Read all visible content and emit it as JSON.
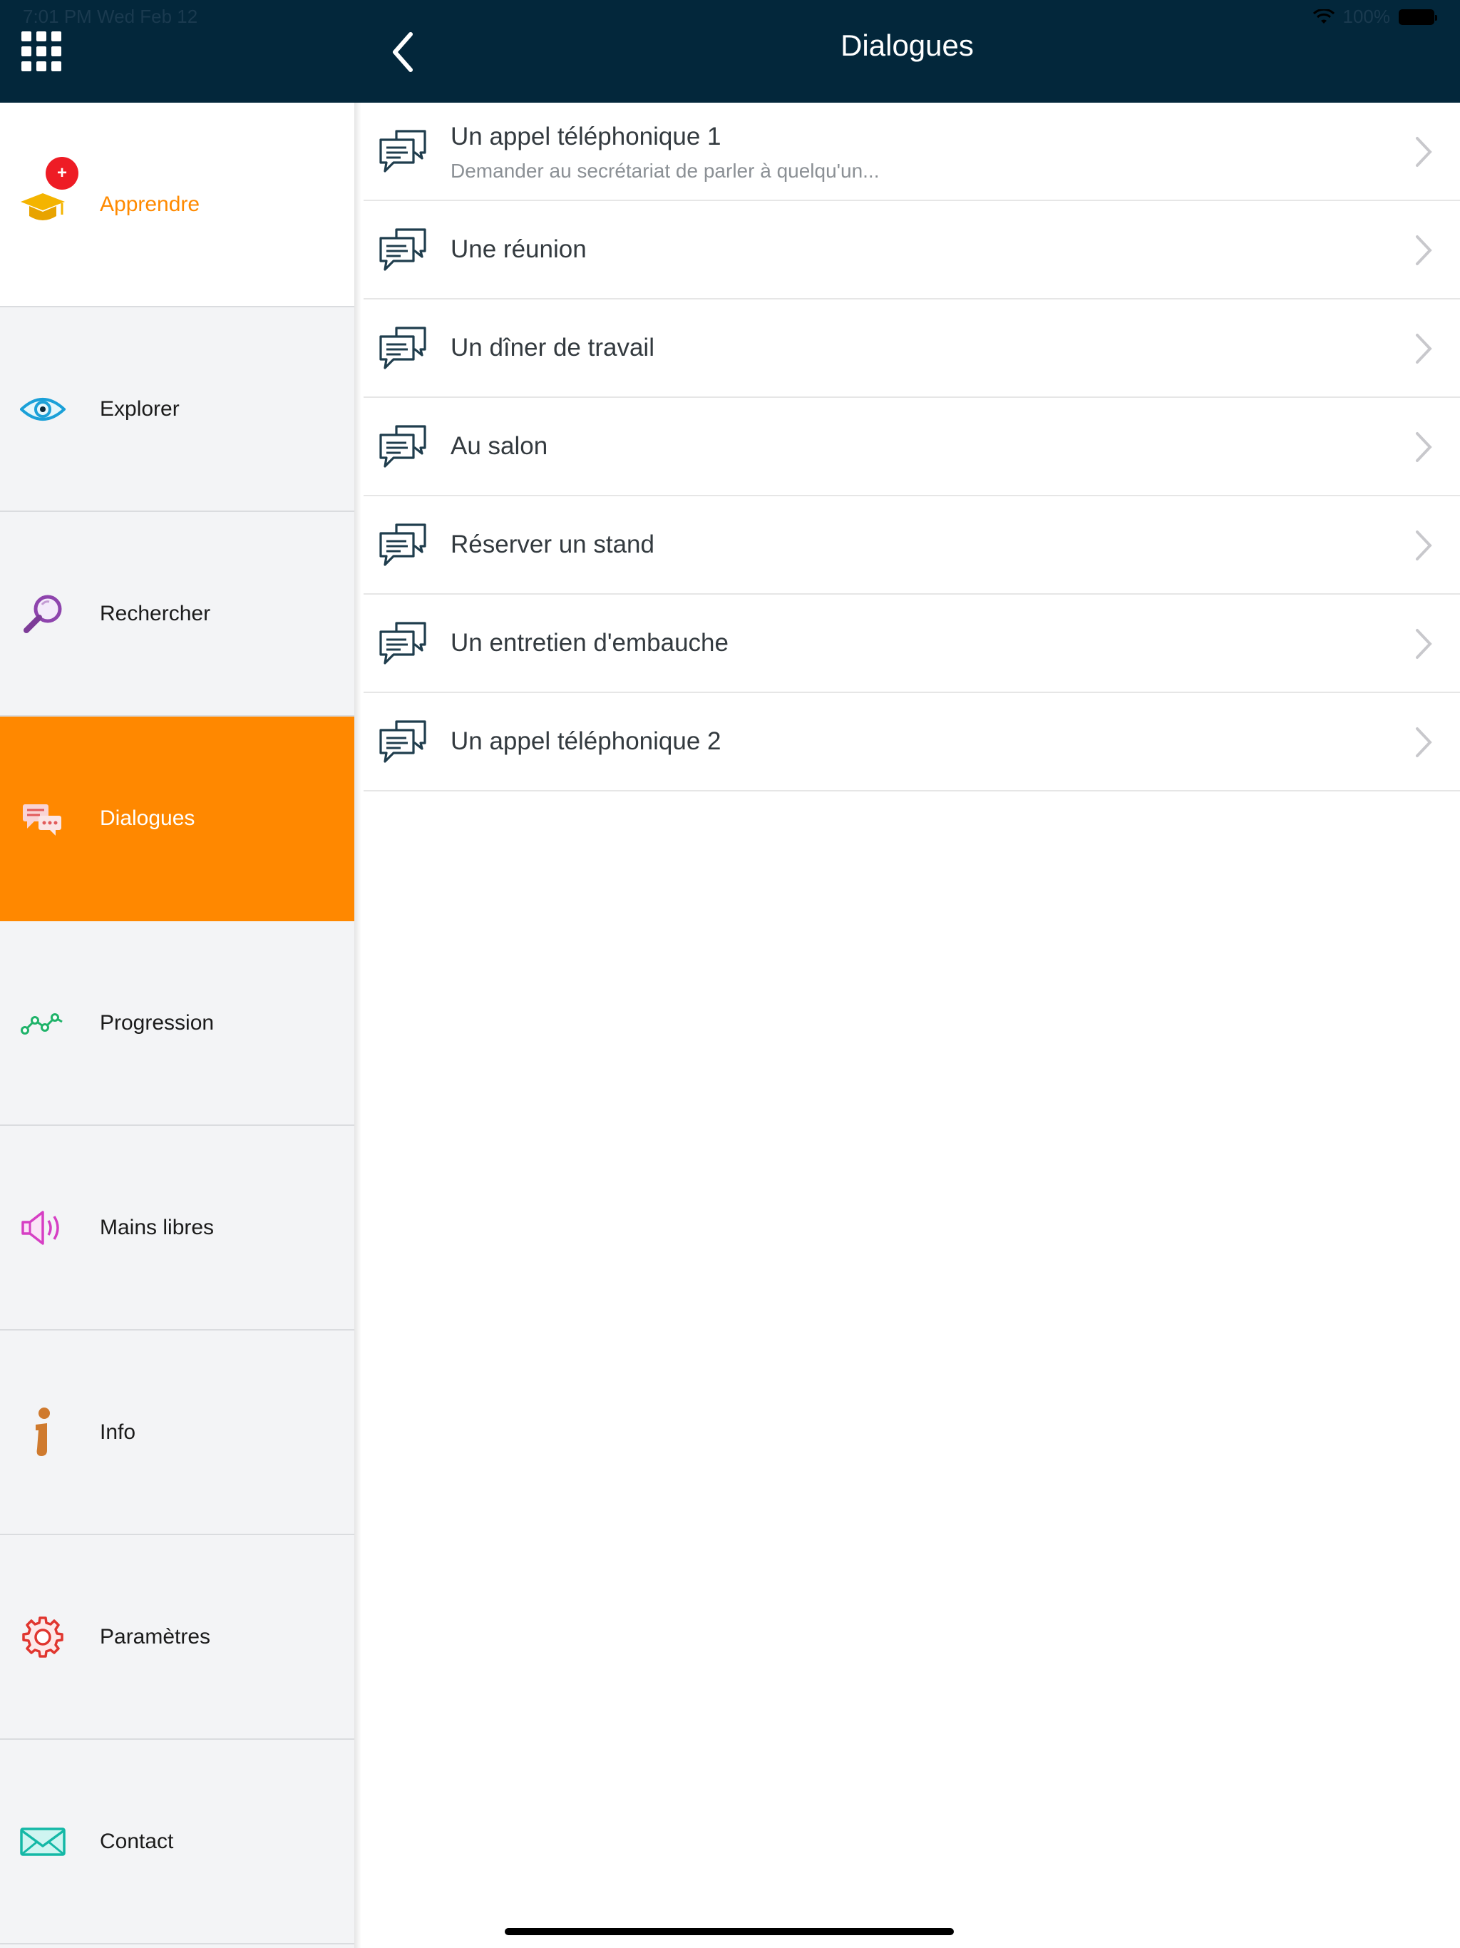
{
  "status": {
    "time_date": "7:01 PM   Wed Feb 12",
    "battery": "100%"
  },
  "header": {
    "title": "Dialogues"
  },
  "sidebar": {
    "items": [
      {
        "label": "Apprendre",
        "badge": "+"
      },
      {
        "label": "Explorer"
      },
      {
        "label": "Rechercher"
      },
      {
        "label": "Dialogues"
      },
      {
        "label": "Progression"
      },
      {
        "label": "Mains libres"
      },
      {
        "label": "Info"
      },
      {
        "label": "Paramètres"
      },
      {
        "label": "Contact"
      }
    ]
  },
  "dialogues": [
    {
      "title": "Un appel téléphonique 1",
      "subtitle": "Demander au secrétariat de parler à quelqu'un..."
    },
    {
      "title": "Une réunion"
    },
    {
      "title": "Un dîner de travail"
    },
    {
      "title": "Au salon"
    },
    {
      "title": "Réserver un stand"
    },
    {
      "title": "Un entretien d'embauche"
    },
    {
      "title": "Un appel téléphonique 2"
    }
  ],
  "colors": {
    "header_bg": "#03273b",
    "accent_orange": "#ff8800",
    "sidebar_bg": "#f3f4f6"
  }
}
